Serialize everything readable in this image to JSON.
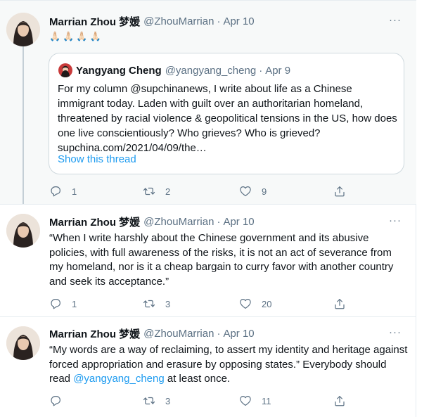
{
  "tweets": [
    {
      "author_name": "Marrian Zhou 梦媛",
      "handle": "@ZhouMarrian",
      "separator": "·",
      "date": "Apr 10",
      "more": "···",
      "emojis": "🙏🏻🙏🏻🙏🏻🙏🏻",
      "quote": {
        "author_name": "Yangyang Cheng",
        "handle": "@yangyang_cheng",
        "separator": "·",
        "date": "Apr 9",
        "text": "For my column @supchinanews, I write about life as a Chinese immigrant today. Laden with guilt over an authoritarian homeland, threatened by racial violence & geopolitical tensions in the US, how does one live conscientiously? Who grieves? Who is grieved?",
        "link": "supchina.com/2021/04/09/the…",
        "show_thread": "Show this thread"
      },
      "replies": "1",
      "retweets": "2",
      "likes": "9"
    },
    {
      "author_name": "Marrian Zhou 梦媛",
      "handle": "@ZhouMarrian",
      "separator": "·",
      "date": "Apr 10",
      "more": "···",
      "text": "“When I write harshly about the Chinese government and its abusive policies, with full awareness of the risks, it is not an act of severance from my homeland, nor is it a cheap bargain to curry favor with another country and seek its acceptance.”",
      "replies": "1",
      "retweets": "3",
      "likes": "20"
    },
    {
      "author_name": "Marrian Zhou 梦媛",
      "handle": "@ZhouMarrian",
      "separator": "·",
      "date": "Apr 10",
      "more": "···",
      "text_before": "“My words are a way of reclaiming, to assert my identity and heritage against forced appropriation and erasure by opposing states.” Everybody should read ",
      "mention": "@yangyang_cheng",
      "text_after": " at least once.",
      "replies": "",
      "retweets": "3",
      "likes": "11"
    }
  ],
  "colors": {
    "text": "#0f1419",
    "muted": "#5b7083",
    "link": "#1d9bf0",
    "thread_bg": "#f7f9f9",
    "border": "#cfd9de"
  },
  "icons": [
    "reply-icon",
    "retweet-icon",
    "like-icon",
    "share-icon",
    "more-icon"
  ]
}
